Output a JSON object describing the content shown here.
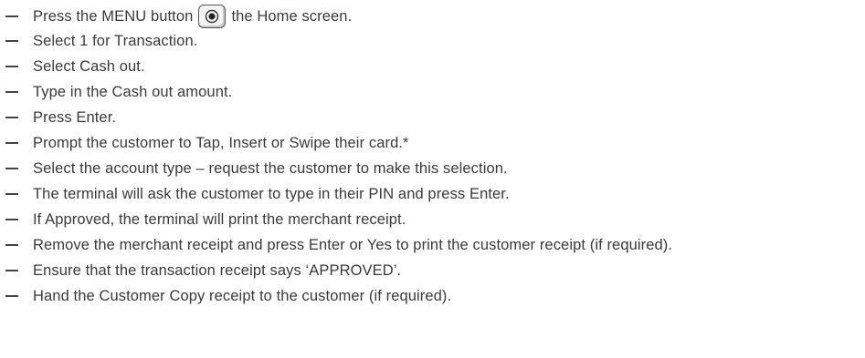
{
  "steps": [
    {
      "before": "Press the MENU button",
      "icon": "menu-button-icon",
      "after": "the Home screen."
    },
    {
      "text": "Select 1 for Transaction."
    },
    {
      "text": "Select Cash out."
    },
    {
      "text": "Type in the Cash out amount."
    },
    {
      "text": "Press Enter."
    },
    {
      "text": "Prompt the customer to Tap, Insert or Swipe their card.*"
    },
    {
      "text": "Select the account type – request the customer to make this selection."
    },
    {
      "text": "The terminal will ask the customer to type in their PIN and press Enter."
    },
    {
      "text": "If Approved, the terminal will print the merchant receipt."
    },
    {
      "text": "Remove the merchant receipt and press Enter or Yes to print the customer receipt (if required)."
    },
    {
      "text": "Ensure that the transaction receipt says ‘APPROVED’."
    },
    {
      "text": "Hand the Customer Copy receipt to the customer (if required)."
    }
  ]
}
